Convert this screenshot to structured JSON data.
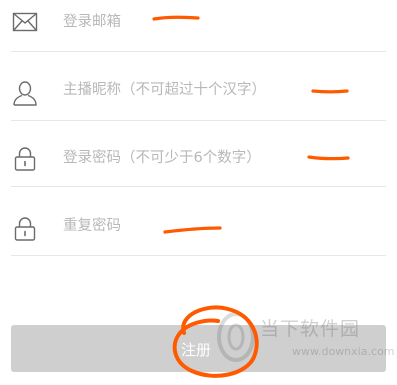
{
  "form": {
    "email": {
      "placeholder": "登录邮箱",
      "value": ""
    },
    "nickname": {
      "placeholder": "主播昵称（不可超过十个汉字）",
      "value": ""
    },
    "password": {
      "placeholder": "登录密码（不可少于6个数字）",
      "value": ""
    },
    "confirm_password": {
      "placeholder": "重复密码",
      "value": ""
    }
  },
  "submit": {
    "label": "注册"
  },
  "watermark": {
    "title": "当下软件园",
    "url": "www.downxia.com"
  },
  "colors": {
    "annotation": "#ff5a00",
    "button_bg": "#cfcfcf",
    "placeholder": "#b8b8b8",
    "icon": "#6b6b6b",
    "divider": "#e6e6e6"
  },
  "icons": {
    "email": "envelope-icon",
    "nickname": "user-icon",
    "password": "lock-icon",
    "confirm_password": "lock-icon"
  }
}
